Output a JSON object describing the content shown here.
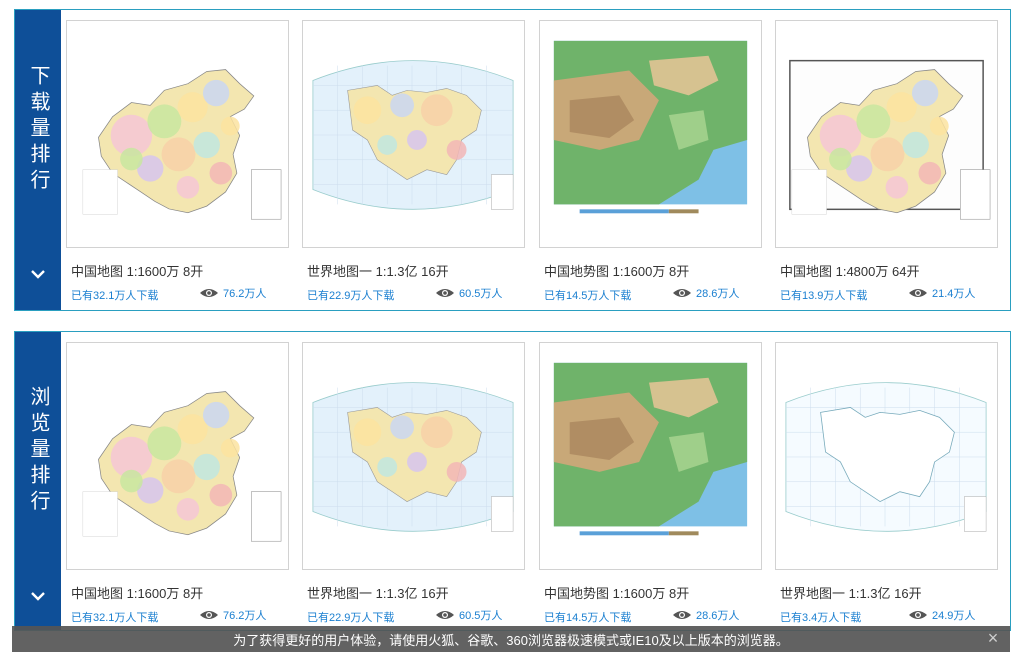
{
  "panels": [
    {
      "title": "下载量排行",
      "cards": [
        {
          "name": "中国地图 1:1600万 8开",
          "downloads": "已有32.1万人下载",
          "views": "76.2万人",
          "style": "china-political"
        },
        {
          "name": "世界地图一 1:1.3亿 16开",
          "downloads": "已有22.9万人下载",
          "views": "60.5万人",
          "style": "world-political"
        },
        {
          "name": "中国地势图 1:1600万 8开",
          "downloads": "已有14.5万人下载",
          "views": "28.6万人",
          "style": "china-terrain"
        },
        {
          "name": "中国地图 1:4800万 64开",
          "downloads": "已有13.9万人下载",
          "views": "21.4万人",
          "style": "china-framed"
        }
      ]
    },
    {
      "title": "浏览量排行",
      "cards": [
        {
          "name": "中国地图 1:1600万 8开",
          "downloads": "已有32.1万人下载",
          "views": "76.2万人",
          "style": "china-political"
        },
        {
          "name": "世界地图一 1:1.3亿 16开",
          "downloads": "已有22.9万人下载",
          "views": "60.5万人",
          "style": "world-political"
        },
        {
          "name": "中国地势图 1:1600万 8开",
          "downloads": "已有14.5万人下载",
          "views": "28.6万人",
          "style": "china-terrain"
        },
        {
          "name": "世界地图一 1:1.3亿 16开",
          "downloads": "已有3.4万人下载",
          "views": "24.9万人",
          "style": "world-outline"
        }
      ]
    }
  ],
  "icons": {
    "expand": "chevron-down-icon",
    "views": "eye-icon",
    "close": "close-icon"
  },
  "notice": {
    "text": "为了获得更好的用户体验，请使用火狐、谷歌、360浏览器极速模式或IE10及以上版本的浏览器。",
    "close": "×"
  },
  "colors": {
    "sidebar": "#0e4f98",
    "border": "#2a9fc0",
    "link": "#1a7fd0",
    "notice_bg": "#555555"
  }
}
